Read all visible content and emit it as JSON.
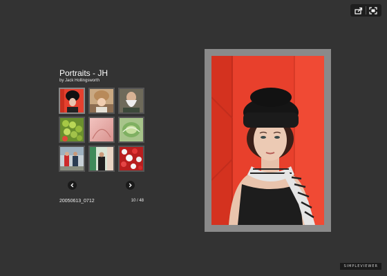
{
  "toolbar": {
    "share_icon": "share-icon",
    "fullscreen_icon": "fullscreen-icon"
  },
  "gallery": {
    "title": "Portraits - JH",
    "byline": "by Jack Hollingsworth"
  },
  "thumbnails": [
    {
      "label": "woman in black fur hat",
      "active": true
    },
    {
      "label": "woman in fur hat",
      "active": false
    },
    {
      "label": "bearded elderly man",
      "active": false
    },
    {
      "label": "green grapes",
      "active": false
    },
    {
      "label": "pink abstract close-up",
      "active": false
    },
    {
      "label": "green cabbage",
      "active": false
    },
    {
      "label": "couple outdoors",
      "active": false
    },
    {
      "label": "man in doorway",
      "active": false
    },
    {
      "label": "red and white flowers",
      "active": false
    }
  ],
  "navigation": {
    "prev_icon": "chevron-left-icon",
    "next_icon": "chevron-right-icon"
  },
  "caption": {
    "filename": "20050613_0712",
    "counter": "10 / 48"
  },
  "brand": {
    "badge": "SIMPLEVIEWER"
  },
  "colors": {
    "background": "#333333",
    "frame": "#8a8a8a",
    "accent_red": "#e63a2a"
  }
}
